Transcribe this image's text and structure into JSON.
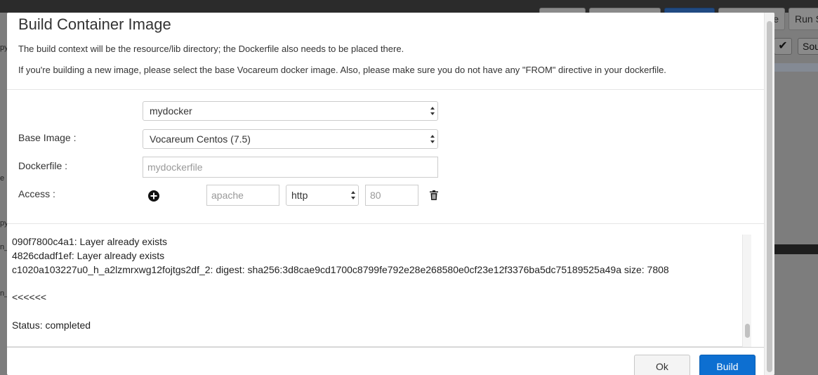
{
  "background": {
    "buttons": [
      "e",
      "Run S"
    ],
    "sou_label": "Sou",
    "fragments": [
      "py",
      "e",
      "py",
      "n_",
      "n_"
    ]
  },
  "modal": {
    "title": "Build Container Image",
    "description_line1": "The build context will be the resource/lib directory; the Dockerfile also needs to be placed there.",
    "description_line2": "If you're building a new image, please select the base Vocareum docker image. Also, please make sure you do not have any \"FROM\" directive in your dockerfile.",
    "image_select": {
      "value": "mydocker"
    },
    "base_image": {
      "label": "Base Image :",
      "value": "Vocareum Centos (7.5)"
    },
    "dockerfile": {
      "label": "Dockerfile :",
      "placeholder": "mydockerfile"
    },
    "access": {
      "label": "Access :",
      "name_placeholder": "apache",
      "protocol": "http",
      "port_placeholder": "80"
    },
    "log_lines": [
      "090f7800c4a1: Layer already exists",
      "4826cdadf1ef: Layer already exists",
      "c1020a103227u0_h_a2lzmrxwg12fojtgs2df_2: digest: sha256:3d8cae9cd1700c8799fe792e28e268580e0cf23e12f3376ba5dc75189525a49a size: 7808",
      "",
      "<<<<<<",
      "",
      "Status: completed"
    ],
    "buttons": {
      "ok": "Ok",
      "build": "Build"
    }
  }
}
